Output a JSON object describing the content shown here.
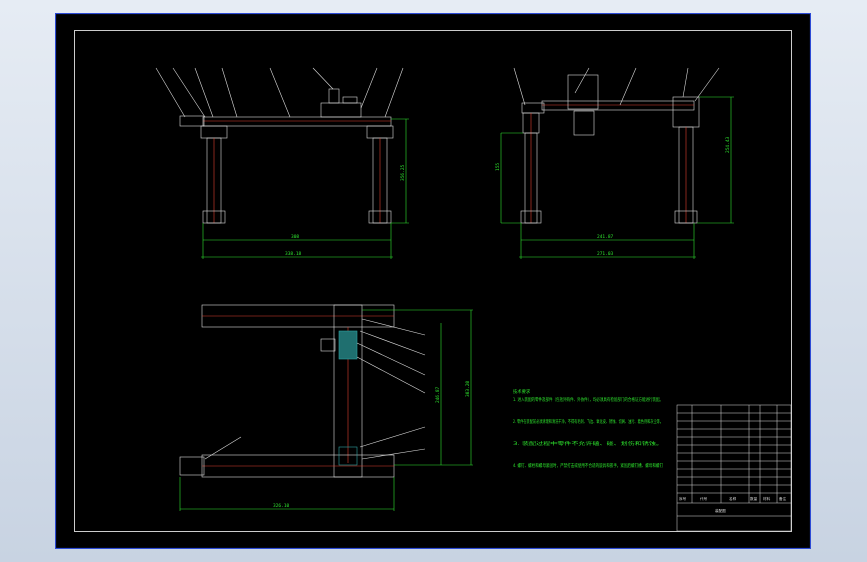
{
  "drawing": {
    "dimensions": {
      "front_span": "308",
      "front_overall": "338.18",
      "front_height": "356.25",
      "side_span": "241.87",
      "side_overall": "271.03",
      "side_left_height": "155",
      "side_right_height": "254.43",
      "top_width": "326.10",
      "top_height_a": "246.87",
      "top_height_b": "303.20"
    },
    "notes": [
      "技术要求",
      "1. 进入装配的零件及部件（包括外购件、外协件），均必须具有检验部门的合格证方能进行装配。",
      "2. 零件在装配前必须清理和清洗干净，不得有毛刺、飞边、氧化皮、锈蚀、切屑、油污、着色剂和灰尘等。",
      "3. 装配过程中零件不允许磕、碰、划伤和锈蚀。",
      "4. 螺钉、螺栓和螺母紧固时，严禁打击或使用不合适的旋具和扳手。紧固后螺钉槽、螺母和螺钉"
    ],
    "title_block": {
      "title": "装配图",
      "header_row": [
        "序号",
        "代号",
        "名称",
        "数量",
        "材料",
        "备注"
      ]
    }
  }
}
